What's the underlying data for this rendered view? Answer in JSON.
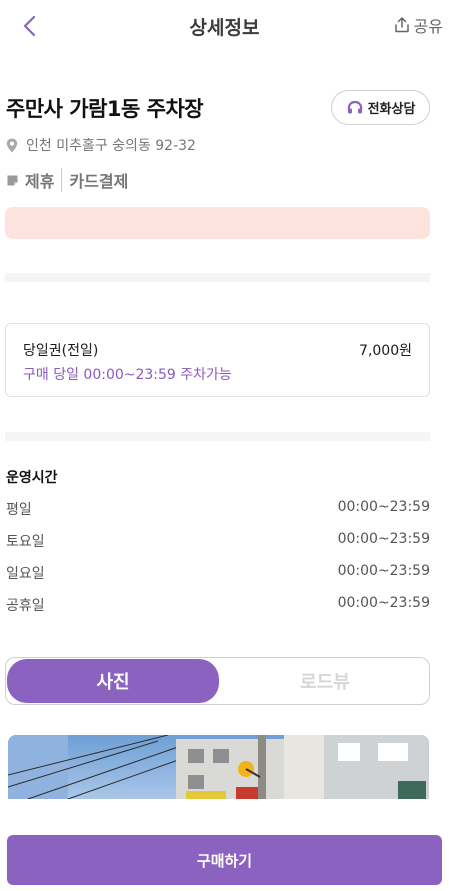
{
  "header": {
    "title": "상세정보",
    "share_label": "공유"
  },
  "place": {
    "name": "주만사 가람1동 주차장",
    "call_label": "전화상담",
    "address": "인천 미추홀구 숭의동 92-32",
    "tags": [
      "제휴",
      "카드결제"
    ]
  },
  "ticket": {
    "name": "당일권(전일)",
    "price": "7,000원",
    "description": "구매 당일 00:00~23:59 주차가능"
  },
  "hours": {
    "title": "운영시간",
    "rows": [
      {
        "day": "평일",
        "time": "00:00~23:59"
      },
      {
        "day": "토요일",
        "time": "00:00~23:59"
      },
      {
        "day": "일요일",
        "time": "00:00~23:59"
      },
      {
        "day": "공휴일",
        "time": "00:00~23:59"
      }
    ]
  },
  "media_toggle": {
    "photo_label": "사진",
    "roadview_label": "로드뷰",
    "selected": "사진"
  },
  "footer": {
    "buy_label": "구매하기"
  },
  "colors": {
    "accent": "#8c62c0",
    "notice_bg": "#fde3de",
    "divider": "#f5f5f7"
  },
  "icons": [
    "back-icon",
    "share-icon",
    "headset-icon",
    "location-pin-icon",
    "tag-icon"
  ]
}
